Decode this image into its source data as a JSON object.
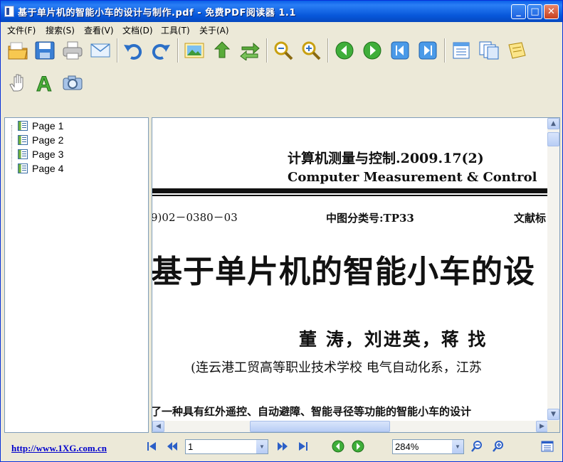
{
  "window": {
    "title": "基于单片机的智能小车的设计与制作.pdf - 免费PDF阅读器 1.1",
    "min": "_",
    "max": "□",
    "close": "✕"
  },
  "menu": [
    "文件(F)",
    "搜索(S)",
    "查看(V)",
    "文档(D)",
    "工具(T)",
    "关于(A)"
  ],
  "sidebar": {
    "pages": [
      "Page 1",
      "Page 2",
      "Page 3",
      "Page 4"
    ]
  },
  "document": {
    "journal_cn": "计算机测量与控制.2009.17(2)",
    "journal_en": "Computer  Measurement  &  Control",
    "article_no": "9)02－0380－03",
    "classification": "中图分类号:TP33",
    "doc_code": "文献标",
    "title": "基于单片机的智能小车的设",
    "authors": "董  涛，刘进英，蒋  找",
    "affiliation": "(连云港工贸高等职业技术学校 电气自动化系，江苏",
    "abstract": "了一种具有红外遥控、自动避障、智能寻径等功能的智能小车的设计"
  },
  "status": {
    "url": "http://www.1XG.com.cn",
    "page_value": "1",
    "zoom_value": "284%"
  },
  "colors": {
    "titlebar": "#0A5FE8",
    "chrome": "#ECE9D8",
    "link": "#0000cc"
  }
}
